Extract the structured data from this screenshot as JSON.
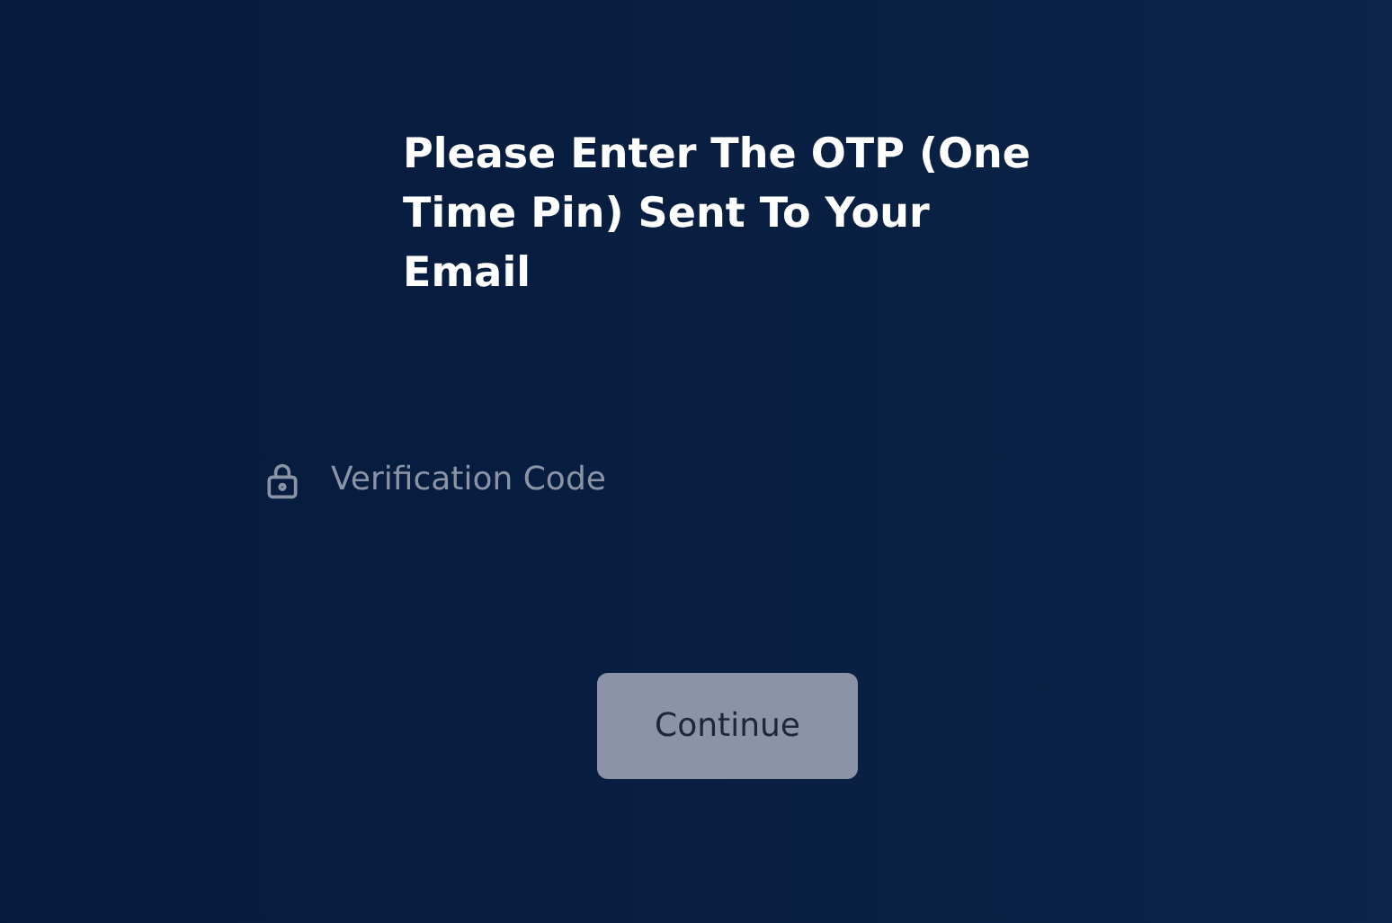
{
  "title": "Please Enter The OTP (One Time Pin) Sent To Your Email",
  "field": {
    "placeholder": "Verification Code"
  },
  "button": {
    "label": "Continue",
    "disabled": true
  }
}
